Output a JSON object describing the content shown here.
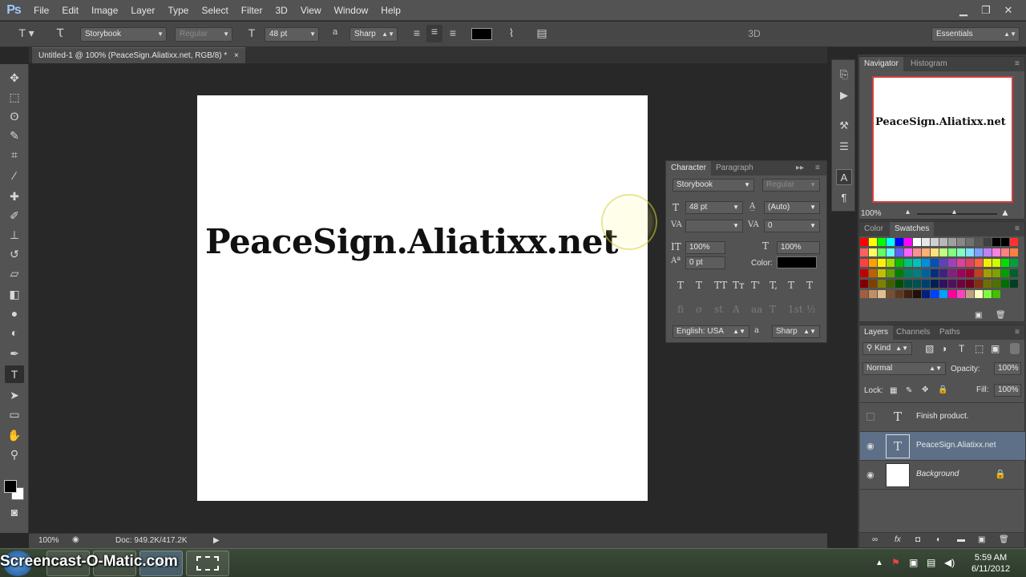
{
  "app": {
    "logo": "Ps",
    "menu": [
      "File",
      "Edit",
      "Image",
      "Layer",
      "Type",
      "Select",
      "Filter",
      "3D",
      "View",
      "Window",
      "Help"
    ]
  },
  "options_bar": {
    "font_family": "Storybook",
    "font_style": "Regular",
    "font_size": "48 pt",
    "aa_label": "a",
    "antialias": "Sharp",
    "mode_3d": "3D",
    "workspace": "Essentials",
    "text_color": "#000000"
  },
  "document": {
    "tab_title": "Untitled-1 @ 100% (PeaceSign.Aliatixx.net, RGB/8) *",
    "tab_close": "×",
    "canvas_text": "PeaceSign.Aliatixx.net"
  },
  "status_bar": {
    "zoom": "100%",
    "doc_info": "Doc: 949.2K/417.2K"
  },
  "character_panel": {
    "tabs": [
      "Character",
      "Paragraph"
    ],
    "font_family": "Storybook",
    "font_style": "Regular",
    "size": "48 pt",
    "leading": "(Auto)",
    "kerning": "",
    "tracking": "0",
    "vertical_scale": "100%",
    "horizontal_scale": "100%",
    "baseline_shift": "0 pt",
    "color_label": "Color:",
    "color": "#000000",
    "language": "English: USA",
    "aa_label": "a",
    "antialias": "Sharp",
    "style_glyphs": [
      "T",
      "T",
      "TT",
      "Tт",
      "T'",
      "T,",
      "T",
      "T"
    ],
    "opentype_glyphs": [
      "fi",
      "ơ",
      "st",
      "A",
      "aa",
      "T",
      "1st",
      "½"
    ]
  },
  "navigator": {
    "tabs": [
      "Navigator",
      "Histogram"
    ],
    "thumb_text": "PeaceSign.Aliatixx.net",
    "zoom": "100%"
  },
  "swatches": {
    "tabs": [
      "Color",
      "Swatches"
    ],
    "rows": [
      [
        "#ff0000",
        "#ffff00",
        "#00ff00",
        "#00ffff",
        "#0000ff",
        "#ff00ff",
        "#ffffff",
        "#e8e8e8",
        "#d0d0d0",
        "#b8b8b8",
        "#a0a0a0",
        "#888888",
        "#707070",
        "#585858",
        "#404040",
        "#000000",
        "#000000",
        "#ff3030"
      ],
      [
        "#ff6060",
        "#ffff60",
        "#60ff60",
        "#60ffff",
        "#6060ff",
        "#ff60ff",
        "#ff9090",
        "#ffb070",
        "#ffe080",
        "#c0ff80",
        "#80ff80",
        "#80ffc0",
        "#80e0ff",
        "#80a0ff",
        "#c080ff",
        "#ff80e0",
        "#ff8080",
        "#ff8040"
      ],
      [
        "#ff4040",
        "#ffa000",
        "#fff000",
        "#a0e000",
        "#00c000",
        "#00c080",
        "#00c0c0",
        "#0090e0",
        "#0050c0",
        "#6040c0",
        "#a040c0",
        "#e040a0",
        "#e04060",
        "#ff6040",
        "#f0f000",
        "#d0ff00",
        "#00e000",
        "#00a040"
      ],
      [
        "#c00000",
        "#c06000",
        "#c0c000",
        "#60a000",
        "#008000",
        "#008060",
        "#008080",
        "#0060a0",
        "#003080",
        "#402080",
        "#802080",
        "#a00060",
        "#a00030",
        "#c04020",
        "#a0a000",
        "#80a000",
        "#00a000",
        "#006030"
      ],
      [
        "#800000",
        "#804000",
        "#808000",
        "#406000",
        "#005000",
        "#005040",
        "#005050",
        "#004070",
        "#002050",
        "#301060",
        "#501060",
        "#700040",
        "#700020",
        "#803010",
        "#707000",
        "#507000",
        "#007000",
        "#004020"
      ],
      [
        "#a06040",
        "#c09060",
        "#e0c090",
        "#7a4f30",
        "#603820",
        "#402010",
        "#201008",
        "#002080",
        "#0040ff",
        "#00a0ff",
        "#ff00a0",
        "#ff40c0",
        "#c0a080",
        "#ffffc0",
        "#80ff40",
        "#40c000"
      ]
    ]
  },
  "layers": {
    "tabs": [
      "Layers",
      "Channels",
      "Paths"
    ],
    "filter_kind": "Kind",
    "blend_mode": "Normal",
    "opacity_label": "Opacity:",
    "opacity": "100%",
    "lock_label": "Lock:",
    "fill_label": "Fill:",
    "fill": "100%",
    "items": [
      {
        "name": "Finish product.",
        "visible": false,
        "type": "text"
      },
      {
        "name": "PeaceSign.Aliatixx.net",
        "visible": true,
        "type": "text"
      },
      {
        "name": "Background",
        "visible": true,
        "type": "image"
      }
    ]
  },
  "taskbar": {
    "clock_time": "5:59 AM",
    "clock_date": "6/11/2012",
    "watermark": "Screencast-O-Matic.com"
  }
}
